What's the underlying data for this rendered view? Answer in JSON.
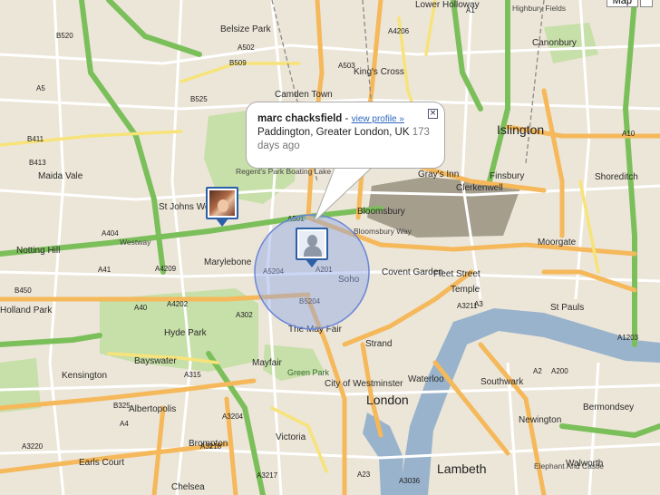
{
  "map_type_label": "Map",
  "info_window": {
    "name": "marc chacksfield",
    "separator": "-",
    "link": "view profile »",
    "location": "Paddington, Greater London, UK",
    "days": "173",
    "ago": "days ago",
    "close_glyph": "×"
  },
  "markers": [
    {
      "name": "user-photo-marker",
      "kind": "photo"
    },
    {
      "name": "anonymous-user-marker",
      "kind": "silhouette"
    }
  ],
  "places": [
    {
      "text": "Lower Holloway"
    },
    {
      "text": "Highbury Fields"
    },
    {
      "text": "Belsize Park"
    },
    {
      "text": "Canonbury"
    },
    {
      "text": "King's Cross"
    },
    {
      "text": "Camden Town"
    },
    {
      "text": "Islington"
    },
    {
      "text": "Regent's Park Boating Lake"
    },
    {
      "text": "Maida Vale"
    },
    {
      "text": "Shoreditch"
    },
    {
      "text": "Gray's Inn"
    },
    {
      "text": "Finsbury"
    },
    {
      "text": "Clerkenwell"
    },
    {
      "text": "St Johns Wood"
    },
    {
      "text": "Bloomsbury"
    },
    {
      "text": "Notting Hill"
    },
    {
      "text": "Marylebone"
    },
    {
      "text": "Westway"
    },
    {
      "text": "Moorgate"
    },
    {
      "text": "Soho"
    },
    {
      "text": "Covent Garden"
    },
    {
      "text": "Fleet Street"
    },
    {
      "text": "Temple"
    },
    {
      "text": "St Pauls"
    },
    {
      "text": "Holland Park"
    },
    {
      "text": "Hyde Park"
    },
    {
      "text": "The May Fair"
    },
    {
      "text": "Bayswater"
    },
    {
      "text": "Strand"
    },
    {
      "text": "Mayfair"
    },
    {
      "text": "Southwark"
    },
    {
      "text": "Kensington"
    },
    {
      "text": "City of Westminster"
    },
    {
      "text": "Waterloo"
    },
    {
      "text": "London"
    },
    {
      "text": "Albertopolis"
    },
    {
      "text": "Bermondsey"
    },
    {
      "text": "Newington"
    },
    {
      "text": "Brompton"
    },
    {
      "text": "Victoria"
    },
    {
      "text": "Earls Court"
    },
    {
      "text": "Chelsea"
    },
    {
      "text": "Lambeth"
    },
    {
      "text": "Walworth"
    },
    {
      "text": "Elephant And Castle"
    },
    {
      "text": "Green Park"
    },
    {
      "text": "Bloomsbury Way"
    }
  ],
  "roads": [
    "A5",
    "A41",
    "A501",
    "A40",
    "A4",
    "A3",
    "A10",
    "A1",
    "A201",
    "A3211",
    "A4202",
    "A315",
    "A302",
    "B411",
    "B413",
    "B450",
    "B509",
    "B520",
    "B525",
    "A502",
    "A503",
    "A1203",
    "A200",
    "A2",
    "A23",
    "A3036",
    "A3204",
    "A3217",
    "A3218",
    "A3220",
    "A404",
    "A4206",
    "A4209",
    "B5204",
    "A5204",
    "B325"
  ]
}
